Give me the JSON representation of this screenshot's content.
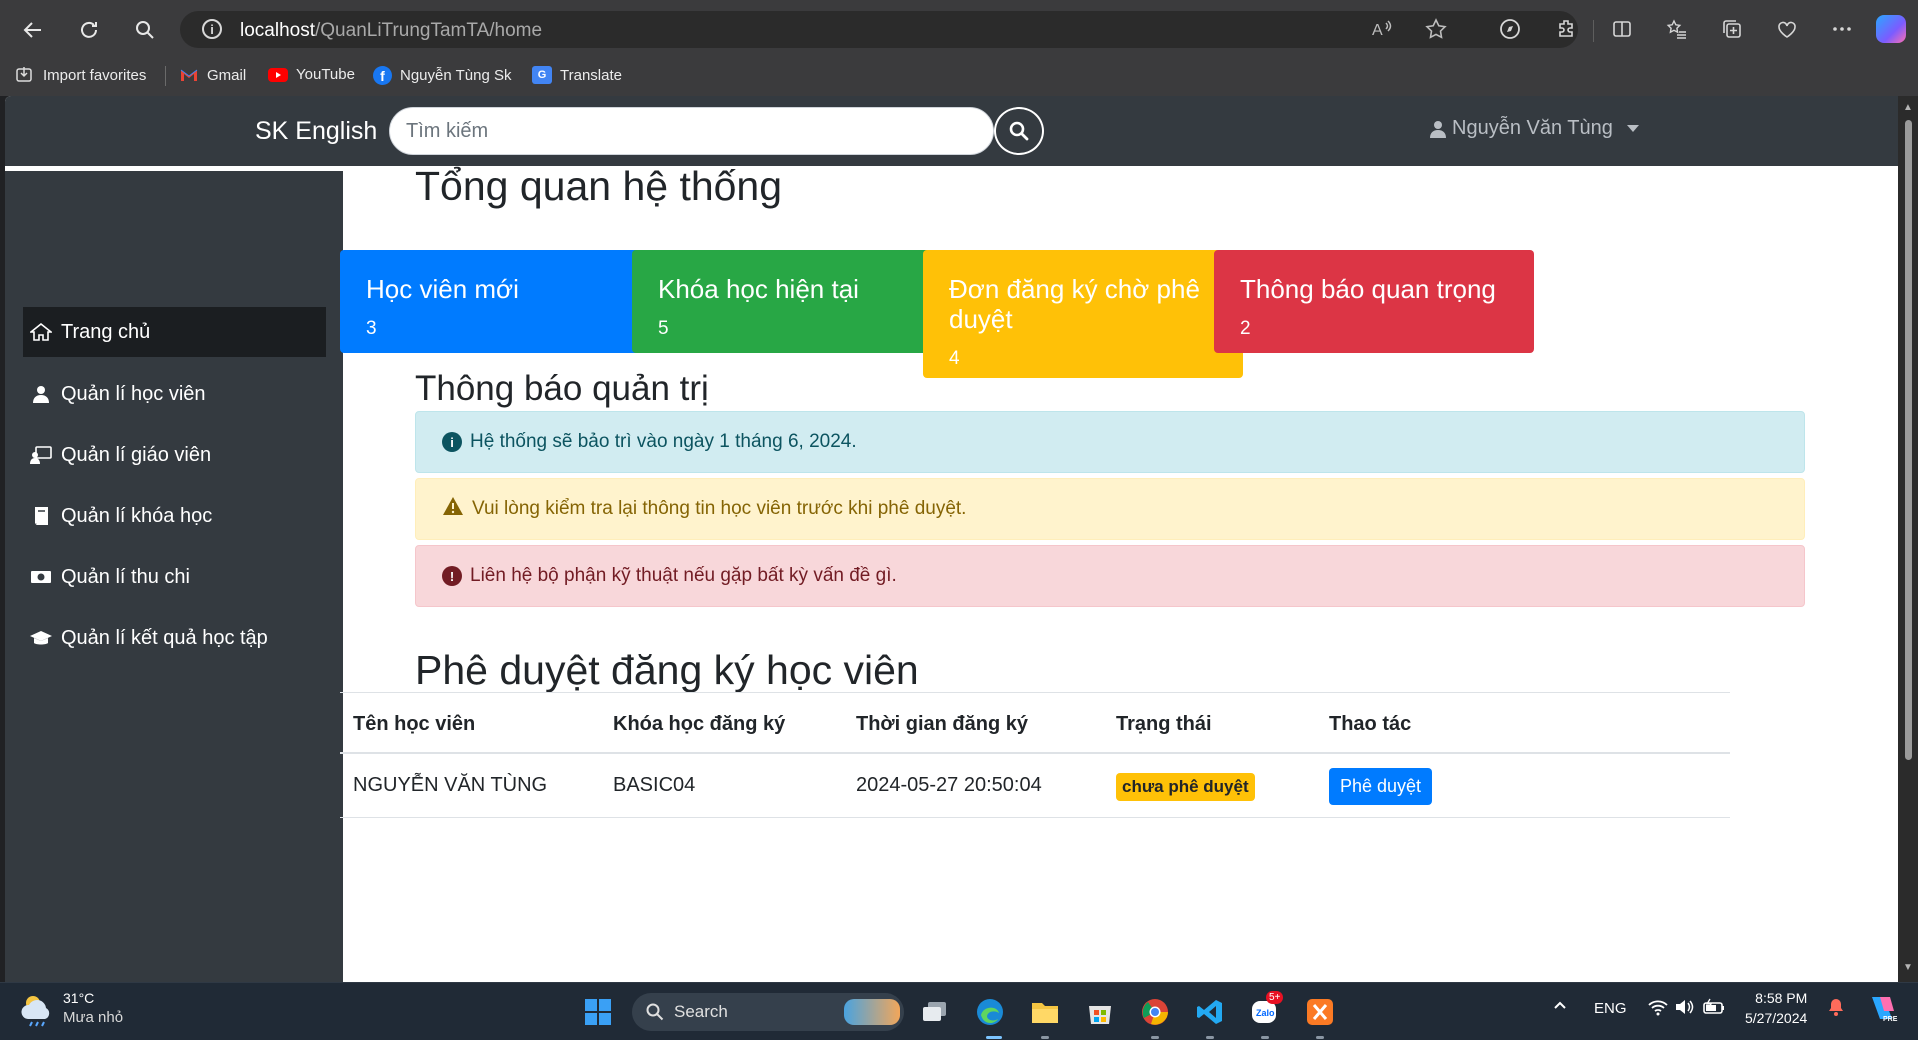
{
  "browser": {
    "url_host": "localhost",
    "url_path": "/QuanLiTrungTamTA/home",
    "bookmarks": [
      {
        "label": "Import favorites",
        "icon": "import-icon"
      },
      {
        "label": "Gmail",
        "icon": "gmail-icon"
      },
      {
        "label": "YouTube",
        "icon": "youtube-icon"
      },
      {
        "label": "Nguyễn Tùng Sk",
        "icon": "facebook-icon"
      },
      {
        "label": "Translate",
        "icon": "translate-icon"
      }
    ]
  },
  "navbar": {
    "brand": "SK English",
    "search_placeholder": "Tìm kiếm",
    "user_name": "Nguyễn Văn Tùng"
  },
  "sidebar": {
    "items": [
      {
        "label": "Trang chủ",
        "icon": "home-icon",
        "active": true
      },
      {
        "label": "Quản lí học viên",
        "icon": "user-icon"
      },
      {
        "label": "Quản lí giáo viên",
        "icon": "teacher-icon"
      },
      {
        "label": "Quản lí khóa học",
        "icon": "book-icon"
      },
      {
        "label": "Quản lí thu chi",
        "icon": "money-icon"
      },
      {
        "label": "Quản lí kết quả học tập",
        "icon": "graduation-cap-icon"
      }
    ]
  },
  "overview": {
    "title": "Tổng quan hệ thống",
    "cards": [
      {
        "title": "Học viên mới",
        "value": "3",
        "color": "#007bff"
      },
      {
        "title": "Khóa học hiện tại",
        "value": "5",
        "color": "#28a745"
      },
      {
        "title": "Đơn đăng ký chờ phê duyệt",
        "value": "4",
        "color": "#ffc107"
      },
      {
        "title": "Thông báo quan trọng",
        "value": "2",
        "color": "#dc3545"
      }
    ]
  },
  "notices": {
    "title": "Thông báo quản trị",
    "alerts": [
      {
        "text": "Hệ thống sẽ bảo trì vào ngày 1 tháng 6, 2024.",
        "type": "info"
      },
      {
        "text": "Vui lòng kiểm tra lại thông tin học viên trước khi phê duyệt.",
        "type": "warning"
      },
      {
        "text": "Liên hệ bộ phận kỹ thuật nếu gặp bất kỳ vấn đề gì.",
        "type": "danger"
      }
    ]
  },
  "approvals": {
    "title": "Phê duyệt đăng ký học viên",
    "columns": [
      "Tên học viên",
      "Khóa học đăng ký",
      "Thời gian đăng ký",
      "Trạng thái",
      "Thao tác"
    ],
    "rows": [
      {
        "name": "NGUYỄN VĂN TÙNG",
        "course": "BASIC04",
        "time": "2024-05-27 20:50:04",
        "status": "chưa phê duyệt",
        "action": "Phê duyệt"
      }
    ]
  },
  "taskbar": {
    "weather_temp": "31°C",
    "weather_desc": "Mưa nhỏ",
    "search_label": "Search",
    "language": "ENG",
    "time": "8:58 PM",
    "date": "5/27/2024",
    "zalo_badge": "5+"
  }
}
